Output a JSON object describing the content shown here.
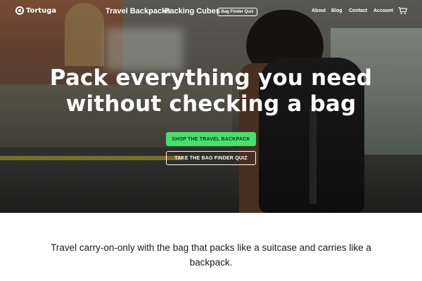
{
  "brand": {
    "name": "Tortuga"
  },
  "nav": {
    "links": [
      "Travel Backpacks",
      "Packing Cubes"
    ],
    "quiz_pill": "Bag Finder Quiz",
    "right_links": [
      "About",
      "Blog",
      "Contact",
      "Account"
    ]
  },
  "hero": {
    "headline": "Pack everything you need without checking a bag",
    "cta_primary": "SHOP THE TRAVEL BACKPACK",
    "cta_secondary": "TAKE THE BAG FINDER QUIZ"
  },
  "tagline": "Travel carry-on-only with the bag that packs like a suitcase and carries like a backpack.",
  "icons": {
    "logo": "turtle-logo-icon",
    "cart": "cart-icon"
  },
  "colors": {
    "cta_green": "#46e06a",
    "text_dark": "#1a1a1a",
    "white": "#ffffff"
  }
}
